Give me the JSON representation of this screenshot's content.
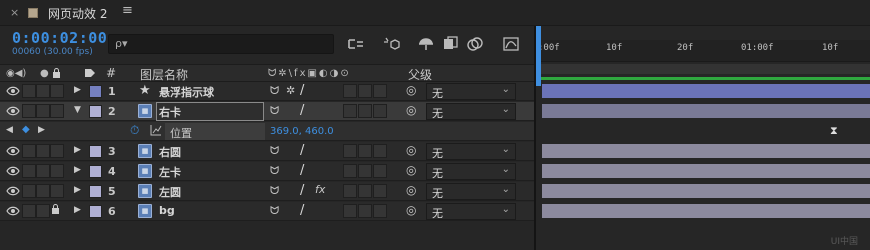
{
  "tab": {
    "close": "×",
    "title": "网页动效 2",
    "menu": "≡"
  },
  "timecode": {
    "time": "0:00:02:00",
    "frames": "00060 (30.00 fps)"
  },
  "search": {
    "icon": "ρ▾"
  },
  "columns": {
    "visibility": "◉◀)",
    "solo": "●",
    "lock": "🔒",
    "label": "◆",
    "num": "#",
    "layer_name": "图层名称",
    "switches": "ᗢ✲\\fx▣◐◑⊙",
    "parent": "父级"
  },
  "layers": [
    {
      "num": "1",
      "name": "悬浮指示球",
      "type": "null",
      "color": "#7580c0",
      "parent": "无",
      "expanded": false
    },
    {
      "num": "2",
      "name": "右卡",
      "type": "precomp",
      "color": "#b0b0d4",
      "parent": "无",
      "expanded": true,
      "editing": true
    },
    {
      "num": "3",
      "name": "右圆",
      "type": "precomp",
      "color": "#b0b0d4",
      "parent": "无",
      "expanded": false
    },
    {
      "num": "4",
      "name": "左卡",
      "type": "precomp",
      "color": "#b0b0d4",
      "parent": "无",
      "expanded": false
    },
    {
      "num": "5",
      "name": "左圆",
      "type": "precomp",
      "color": "#b0b0d4",
      "parent": "无",
      "expanded": false,
      "fx": "fx"
    },
    {
      "num": "6",
      "name": "bg",
      "type": "precomp",
      "color": "#b0b0d4",
      "parent": "无",
      "expanded": false,
      "locked": true
    }
  ],
  "property": {
    "name": "位置",
    "value": "369.0, 460.0"
  },
  "switch_glyphs": {
    "shy": "ᗢ",
    "collapse": "✲",
    "quality": "/",
    "parent_pick": "◎"
  },
  "ruler": {
    "ticks": [
      ":00f",
      "10f",
      "20f",
      "01:00f",
      "10f"
    ]
  },
  "watermark": "UI中国",
  "colors": {
    "accent": "#3d8fe0",
    "work_area_green": "#2fa83f",
    "layer_purple": "#7580c0",
    "layer_gray": "#8c8a9e"
  }
}
